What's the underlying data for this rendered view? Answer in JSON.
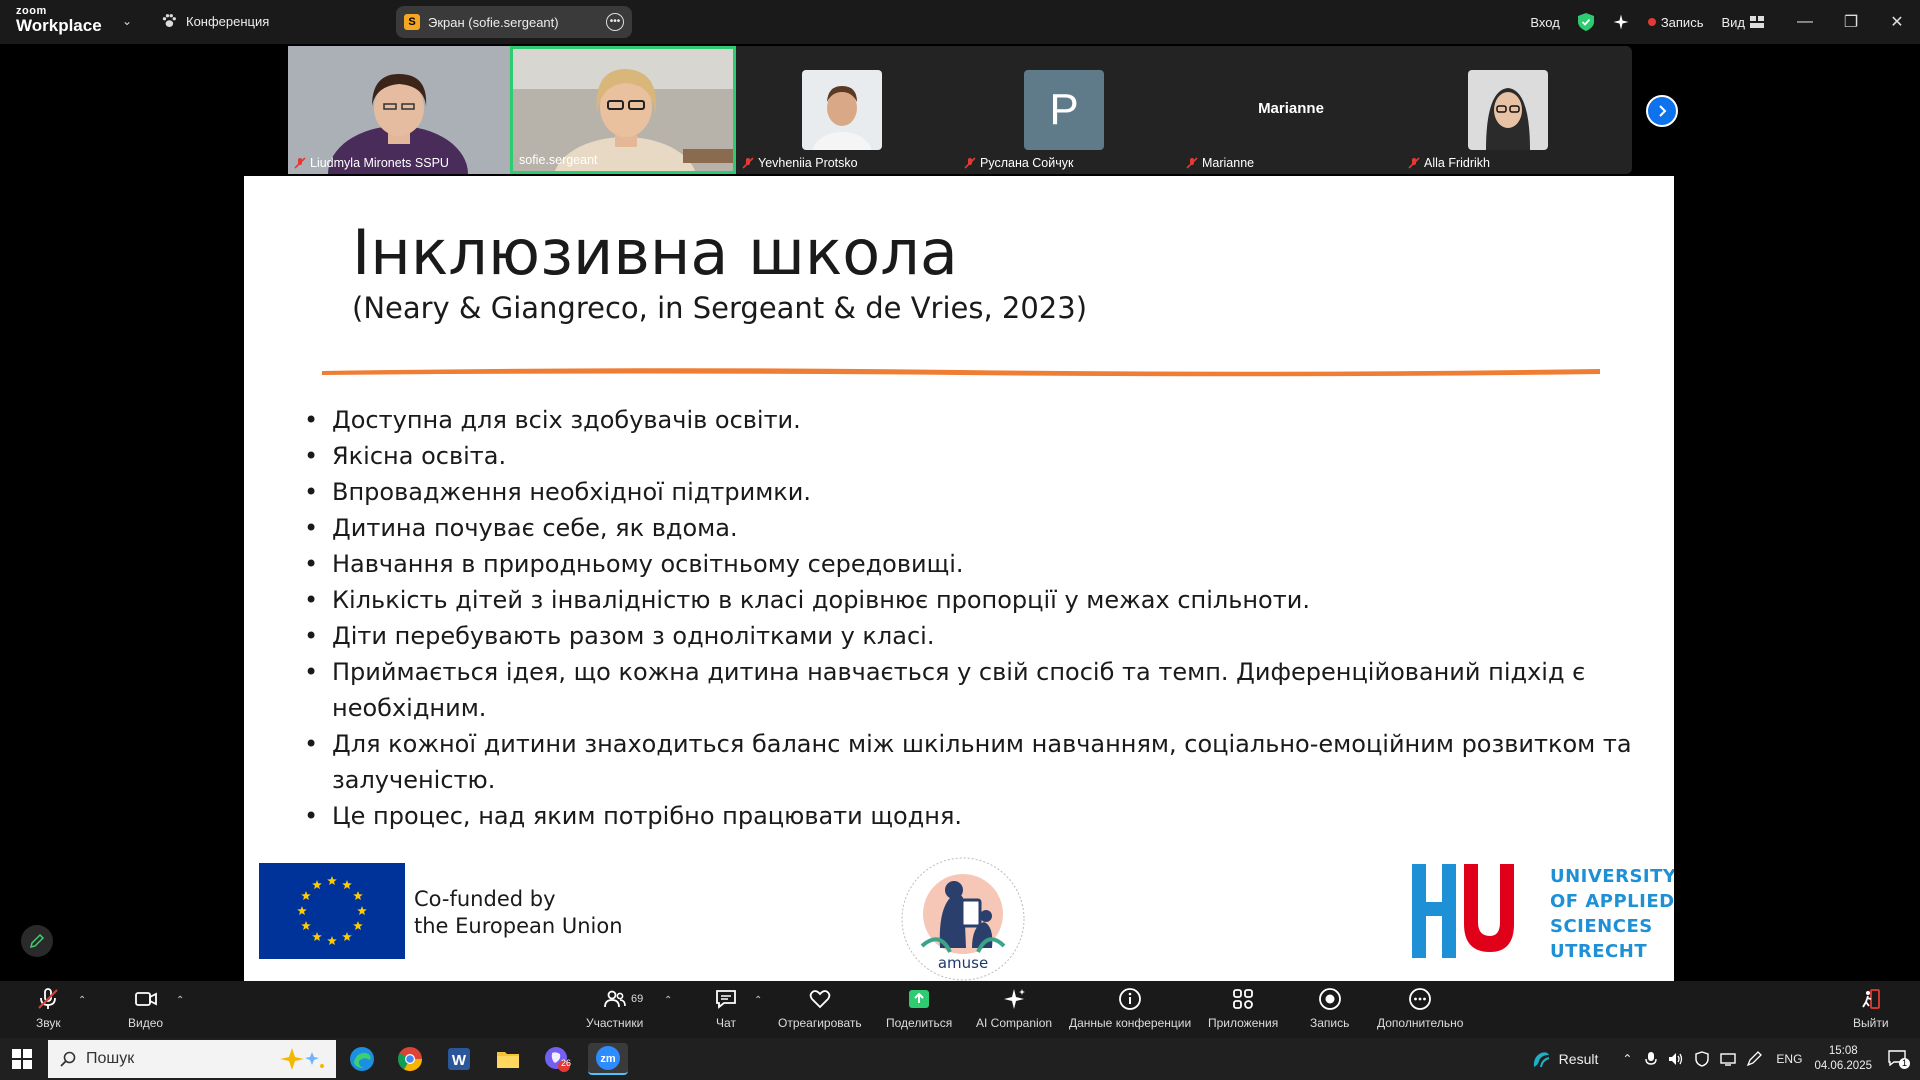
{
  "topbar": {
    "brand_small": "zoom",
    "brand_big": "Workplace",
    "conference_label": "Конференция",
    "screen_share_letter": "S",
    "screen_share_label": "Экран (sofie.sergeant)",
    "signin_label": "Вход",
    "record_label": "Запись",
    "view_label": "Вид"
  },
  "participants": [
    {
      "name": "Liudmyla Mironets SSPU",
      "type": "video"
    },
    {
      "name": "sofie.sergeant",
      "type": "video",
      "active": true
    },
    {
      "name": "Yevheniia Protsko",
      "type": "photo"
    },
    {
      "name": "Руслана Сойчук",
      "type": "letter",
      "letter": "P"
    },
    {
      "name": "Marianne",
      "type": "text",
      "display": "Marianne"
    },
    {
      "name": "Alla Fridrikh",
      "type": "photo"
    }
  ],
  "slide": {
    "title": "Інклюзивна школа",
    "subtitle": "(Neary & Giangreco, in Sergeant & de Vries, 2023)",
    "bullets": [
      "Доступна для всіх здобувачів освіти.",
      "Якісна освіта.",
      "Впровадження необхідної підтримки.",
      "Дитина  почуває себе, як вдома.",
      "Навчання в природньому освітньому середовищі.",
      "Кількість дітей з інвалідністю в класі дорівнює пропорції у межах спільноти.",
      "Діти перебувають разом з однолітками у класі.",
      "Приймається ідея, що кожна дитина навчається у свій спосіб та темп. Диференційований підхід є необхідним.",
      "Для кожної дитини знаходиться баланс між шкільним навчанням, соціально-емоційним розвитком та залученістю.",
      "Це процес, над яким потрібно працювати щодня."
    ],
    "eu_line1": "Co-funded by",
    "eu_line2": "the European Union",
    "amuse_label": "amuse",
    "hu_lines": [
      "UNIVERSITY",
      "OF APPLIED",
      "SCIENCES",
      "UTRECHT"
    ]
  },
  "toolbar": {
    "audio": "Звук",
    "video": "Видео",
    "participants": "Участники",
    "participants_count": "69",
    "chat": "Чат",
    "react": "Отреагировать",
    "share": "Поделиться",
    "ai": "AI Companion",
    "info": "Данные конференции",
    "apps": "Приложения",
    "record": "Запись",
    "more": "Дополнительно",
    "leave": "Выйти"
  },
  "taskbar": {
    "search_placeholder": "Пошук",
    "weather": "Result",
    "lang": "ENG",
    "time": "15:08",
    "date": "04.06.2025",
    "viber_badge": "26",
    "notif_badge": "1"
  },
  "colors": {
    "accent_green": "#2ecc71",
    "zoom_blue": "#0e72ed",
    "brush_orange": "#ef7d33",
    "hu_blue": "#1e90d6",
    "hu_red": "#e1001a"
  }
}
